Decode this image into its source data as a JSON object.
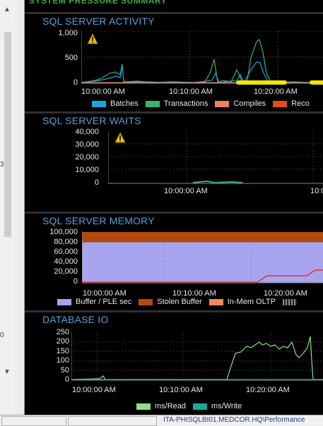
{
  "header": {
    "title": "SYSTEM PRESSURE SUMMARY"
  },
  "colors": {
    "accent": "#5aa0d8",
    "warning": "#f2c200"
  },
  "activity": {
    "title": "SQL SERVER ACTIVITY",
    "yticks": [
      "1,000",
      "500",
      "0"
    ],
    "xticks": [
      "10:00:00 AM",
      "10:10:00 AM",
      "10:20:00 AM"
    ],
    "legend": [
      {
        "label": "Batches",
        "color": "#1aa5e0"
      },
      {
        "label": "Transactions",
        "color": "#3cb36b"
      },
      {
        "label": "Compiles",
        "color": "#f08060"
      },
      {
        "label": "Recompiles",
        "color": "#e84a1c"
      }
    ],
    "legend_visible": [
      "Batches",
      "Transactions",
      "Compiles",
      "Reco"
    ]
  },
  "waits": {
    "title": "SQL SERVER WAITS",
    "yticks": [
      "40,000",
      "30,000",
      "20,000",
      "10,000",
      "0"
    ],
    "xticks": [
      "10:00:00 AM",
      "10:0"
    ]
  },
  "memory": {
    "title": "SQL SERVER MEMORY",
    "yticks": [
      "100,000",
      "80,000",
      "60,000",
      "40,000",
      "20,000",
      "0"
    ],
    "xticks": [
      "10:00:00 AM",
      "10:10:00 AM",
      "10:20:00 AM"
    ],
    "legend": [
      {
        "label": "Buffer / PLE sec",
        "color": "#a8a4ee"
      },
      {
        "label": "Stolen Buffer",
        "color": "#b34a0c"
      },
      {
        "label": "In-Mem OLTP",
        "color": "#f08a60"
      }
    ]
  },
  "dbio": {
    "title": "DATABASE IO",
    "yticks": [
      "250",
      "200",
      "150",
      "100",
      "50",
      "0"
    ],
    "xticks": [
      "10:00:00 AM",
      "10:10:00 AM",
      "10:20:00 AM"
    ],
    "legend": [
      {
        "label": "ms/Read",
        "color": "#8fe08a"
      },
      {
        "label": "ms/Write",
        "color": "#1aa89a"
      }
    ]
  },
  "statusbar": {
    "text": "ITA-PHISQLBI01.MEDCOR.HQ\\Performance"
  },
  "sidebar": {
    "mark1": "3",
    "mark2": "0"
  }
}
